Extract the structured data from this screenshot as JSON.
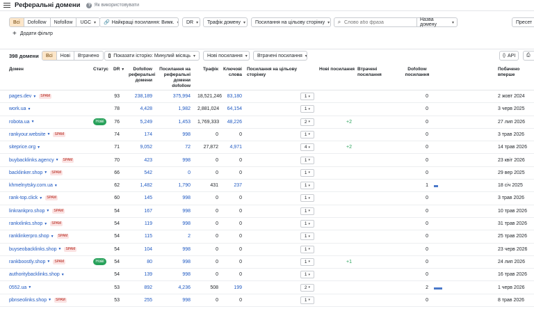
{
  "header": {
    "title": "Реферальні домени",
    "help": "Як використовувати"
  },
  "filters": {
    "link_types": [
      "Всі",
      "Dofollow",
      "Nofollow",
      "UGC"
    ],
    "best_links": "Найкращі посилання: Вимк.",
    "dr": "DR",
    "traffic": "Трафік домену",
    "target": "Посилання на цільову сторінку",
    "search_placeholder": "Слово або фраза",
    "search_scope": "Назва домену",
    "presets": "Пресет",
    "add_filter": "Додати фільтр"
  },
  "toolbar": {
    "count": "398 домени",
    "tabs": [
      "Всі",
      "Нові",
      "Втрачено"
    ],
    "history": "Показати історію: Минулий місяць",
    "new_links": "Нові посилання",
    "lost_links": "Втрачені посилання",
    "api": "API"
  },
  "columns": {
    "domain": "Домен",
    "status": "Статус",
    "dr": "DR",
    "dofollow": "Dofollow реферальні домени",
    "links_to_ref": "Посилання на реферальні домени dofollow",
    "traffic": "Трафік",
    "keywords": "Ключові слова",
    "links_target": "Посилання на цільову сторінку",
    "new_links": "Нові посилання",
    "lost_links": "Втрачені посилання",
    "dofollow_links": "Dofollow посилання",
    "first_seen": "Побачено вперше"
  },
  "rows": [
    {
      "domain": "pages.dev",
      "spam": "SPAM",
      "status": "",
      "dr": "93",
      "dofollow": "238,189",
      "links": "375,994",
      "traffic": "18,521,246",
      "keywords": "83,180",
      "target": "1",
      "new": "",
      "lost": "",
      "dflinks": "0",
      "bar": 0,
      "first": "2 жовт 2024"
    },
    {
      "domain": "work.ua",
      "spam": "",
      "status": "",
      "dr": "78",
      "dofollow": "4,428",
      "links": "1,982",
      "traffic": "2,881,024",
      "keywords": "64,154",
      "target": "1",
      "new": "",
      "lost": "",
      "dflinks": "0",
      "bar": 0,
      "first": "3 черв 2025"
    },
    {
      "domain": "robota.ua",
      "spam": "",
      "status": "Нові",
      "dr": "76",
      "dofollow": "5,249",
      "links": "1,453",
      "traffic": "1,769,333",
      "keywords": "48,226",
      "target": "2",
      "new": "+2",
      "lost": "",
      "dflinks": "0",
      "bar": 0,
      "first": "27 лип 2026"
    },
    {
      "domain": "rankyour.website",
      "spam": "SPAM",
      "status": "",
      "dr": "74",
      "dofollow": "174",
      "links": "998",
      "traffic": "0",
      "keywords": "0",
      "target": "1",
      "new": "",
      "lost": "",
      "dflinks": "0",
      "bar": 0,
      "first": "3 трав 2026"
    },
    {
      "domain": "siteprice.org",
      "spam": "",
      "status": "",
      "dr": "71",
      "dofollow": "9,052",
      "links": "72",
      "traffic": "27,872",
      "keywords": "4,971",
      "target": "4",
      "new": "+2",
      "lost": "",
      "dflinks": "0",
      "bar": 0,
      "first": "14 трав 2026"
    },
    {
      "domain": "buybacklinks.agency",
      "spam": "SPAM",
      "status": "",
      "dr": "70",
      "dofollow": "423",
      "links": "998",
      "traffic": "0",
      "keywords": "0",
      "target": "1",
      "new": "",
      "lost": "",
      "dflinks": "0",
      "bar": 0,
      "first": "23 квіт 2026"
    },
    {
      "domain": "backlinker.shop",
      "spam": "SPAM",
      "status": "",
      "dr": "66",
      "dofollow": "542",
      "links": "0",
      "traffic": "0",
      "keywords": "0",
      "target": "1",
      "new": "",
      "lost": "",
      "dflinks": "0",
      "bar": 0,
      "first": "29 вер 2025"
    },
    {
      "domain": "khmelnytsky.com.ua",
      "spam": "",
      "status": "",
      "dr": "62",
      "dofollow": "1,482",
      "links": "1,790",
      "traffic": "431",
      "keywords": "237",
      "target": "1",
      "new": "",
      "lost": "",
      "dflinks": "1",
      "bar": 1,
      "first": "18 січ 2025"
    },
    {
      "domain": "rank-top.click",
      "spam": "SPAM",
      "status": "",
      "dr": "60",
      "dofollow": "145",
      "links": "998",
      "traffic": "0",
      "keywords": "0",
      "target": "1",
      "new": "",
      "lost": "",
      "dflinks": "0",
      "bar": 0,
      "first": "3 трав 2026"
    },
    {
      "domain": "linkrankpro.shop",
      "spam": "SPAM",
      "status": "",
      "dr": "54",
      "dofollow": "167",
      "links": "998",
      "traffic": "0",
      "keywords": "0",
      "target": "1",
      "new": "",
      "lost": "",
      "dflinks": "0",
      "bar": 0,
      "first": "10 трав 2026"
    },
    {
      "domain": "rankxlinks.shop",
      "spam": "SPAM",
      "status": "",
      "dr": "54",
      "dofollow": "119",
      "links": "998",
      "traffic": "0",
      "keywords": "0",
      "target": "1",
      "new": "",
      "lost": "",
      "dflinks": "0",
      "bar": 0,
      "first": "31 трав 2026"
    },
    {
      "domain": "ranklinkerpro.shop",
      "spam": "SPAM",
      "status": "",
      "dr": "54",
      "dofollow": "115",
      "links": "2",
      "traffic": "0",
      "keywords": "0",
      "target": "1",
      "new": "",
      "lost": "",
      "dflinks": "0",
      "bar": 0,
      "first": "25 трав 2026"
    },
    {
      "domain": "buyseobacklinks.shop",
      "spam": "SPAM",
      "status": "",
      "dr": "54",
      "dofollow": "104",
      "links": "998",
      "traffic": "0",
      "keywords": "0",
      "target": "1",
      "new": "",
      "lost": "",
      "dflinks": "0",
      "bar": 0,
      "first": "23 черв 2026"
    },
    {
      "domain": "rankboostly.shop",
      "spam": "SPAM",
      "status": "Нові",
      "dr": "54",
      "dofollow": "80",
      "links": "998",
      "traffic": "0",
      "keywords": "0",
      "target": "1",
      "new": "+1",
      "lost": "",
      "dflinks": "0",
      "bar": 0,
      "first": "24 лип 2026"
    },
    {
      "domain": "authoritybacklinks.shop",
      "spam": "",
      "status": "",
      "dr": "54",
      "dofollow": "139",
      "links": "998",
      "traffic": "0",
      "keywords": "0",
      "target": "1",
      "new": "",
      "lost": "",
      "dflinks": "0",
      "bar": 0,
      "first": "16 трав 2026"
    },
    {
      "domain": "0552.ua",
      "spam": "",
      "status": "",
      "dr": "53",
      "dofollow": "892",
      "links": "4,236",
      "traffic": "508",
      "keywords": "199",
      "target": "2",
      "new": "",
      "lost": "",
      "dflinks": "2",
      "bar": 2,
      "first": "1 черв 2026"
    },
    {
      "domain": "pbnseolinks.shop",
      "spam": "SPAM",
      "status": "",
      "dr": "53",
      "dofollow": "255",
      "links": "998",
      "traffic": "0",
      "keywords": "0",
      "target": "1",
      "new": "",
      "lost": "",
      "dflinks": "0",
      "bar": 0,
      "first": "8 трав 2026"
    }
  ]
}
